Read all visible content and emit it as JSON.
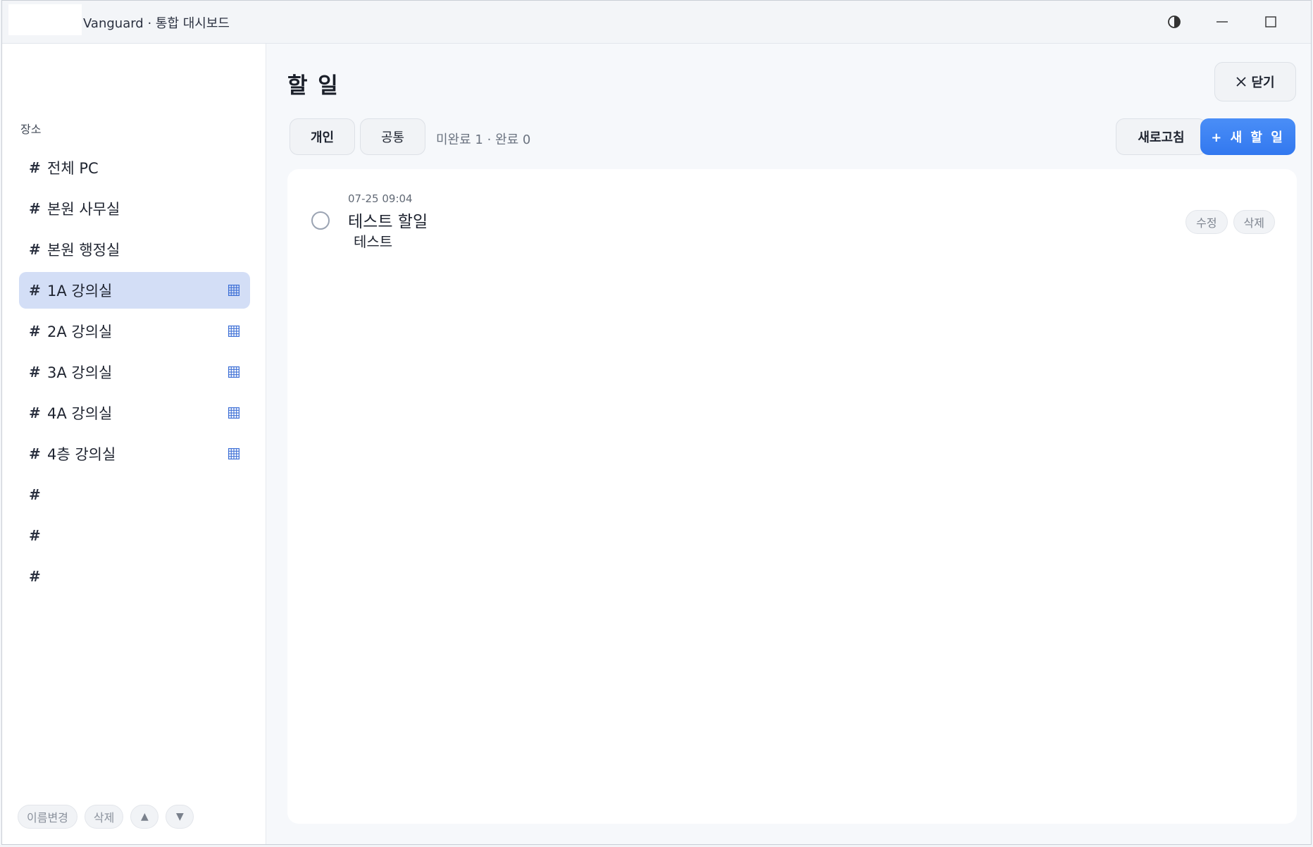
{
  "window": {
    "title": "Vanguard · 통합 대시보드"
  },
  "sidebar": {
    "heading": "장소",
    "items": [
      {
        "label": "전체 PC",
        "grid": false,
        "active": false
      },
      {
        "label": "본원 사무실",
        "grid": false,
        "active": false
      },
      {
        "label": "본원 행정실",
        "grid": false,
        "active": false
      },
      {
        "label": "1A 강의실",
        "grid": true,
        "active": true
      },
      {
        "label": "2A 강의실",
        "grid": true,
        "active": false
      },
      {
        "label": "3A 강의실",
        "grid": true,
        "active": false
      },
      {
        "label": "4A 강의실",
        "grid": true,
        "active": false
      },
      {
        "label": "4층 강의실",
        "grid": true,
        "active": false
      },
      {
        "label": "",
        "grid": false,
        "active": false
      },
      {
        "label": "",
        "grid": false,
        "active": false
      },
      {
        "label": "",
        "grid": false,
        "active": false
      }
    ],
    "footer": {
      "rename_label": "이름변경",
      "delete_label": "삭제",
      "up_label": "▲",
      "down_label": "▼"
    }
  },
  "main": {
    "title": "할 일",
    "close_label": "닫기",
    "tabs": {
      "personal": "개인",
      "shared": "공통"
    },
    "counts": "미완료 1 · 완료 0",
    "refresh_label": "새로고침",
    "new_label": "+ 새 할 일",
    "todos": [
      {
        "time": "07-25 09:04",
        "title": "테스트 할일",
        "desc": "테스트",
        "edit_label": "수정",
        "delete_label": "삭제"
      }
    ]
  },
  "colors": {
    "accent": "#3a7ff2",
    "active_item": "#d3def6",
    "grid_icon": "#3d6fd6"
  }
}
